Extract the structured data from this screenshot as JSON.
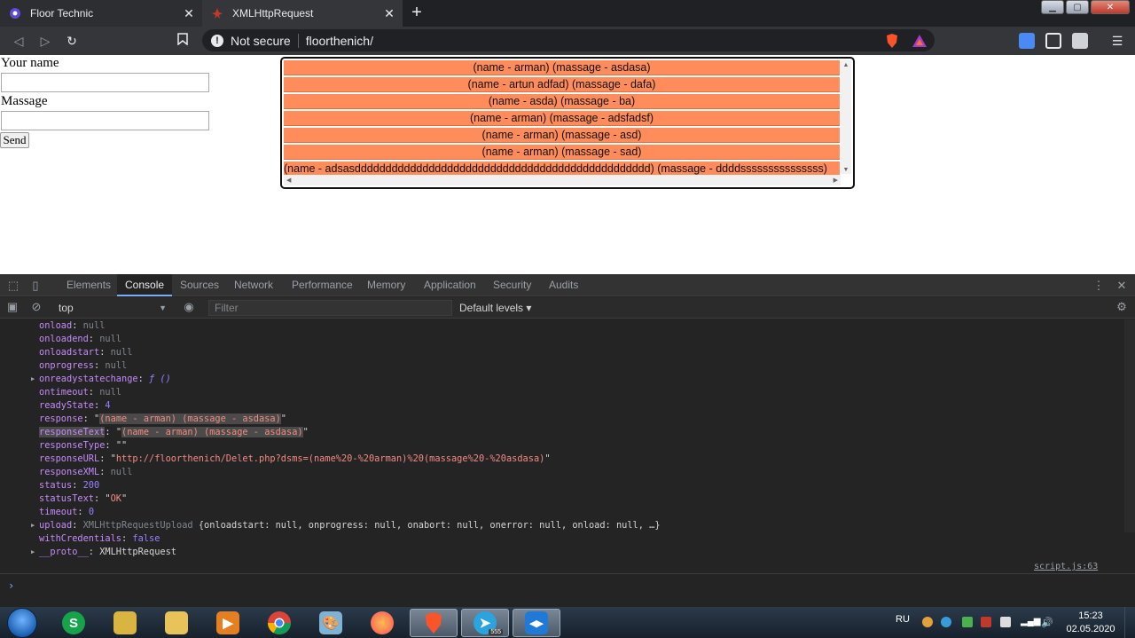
{
  "browser": {
    "tabs": [
      {
        "title": "Floor Technic",
        "close": "✕"
      },
      {
        "title": "XMLHttpRequest",
        "close": "✕"
      }
    ],
    "new_tab": "+",
    "security_label": "Not secure",
    "url": "floorthenich/",
    "colors": {
      "tabstrip": "#202124",
      "toolbar": "#35363a"
    }
  },
  "page": {
    "name_label": "Your name",
    "name_value": "",
    "message_label": "Massage",
    "message_value": "",
    "send_label": "Send",
    "messages": [
      "(name - arman) (massage - asdasa)",
      "(name - artun adfad) (massage - dafa)",
      "(name - asda) (massage - ba)",
      "(name - arman) (massage - adsfadsf)",
      "(name - arman) (massage - asd)",
      "(name - arman) (massage - sad)",
      "(name - adsasdddddddddddddddddddddddddddddddddddddddddddddddd) (massage - ddddsssssssssssssss)"
    ],
    "message_row_color": "#ff8c5a"
  },
  "devtools": {
    "tabs": [
      "Elements",
      "Console",
      "Sources",
      "Network",
      "Performance",
      "Memory",
      "Application",
      "Security",
      "Audits"
    ],
    "active_tab": "Console",
    "context": "top",
    "filter_placeholder": "Filter",
    "levels": "Default levels ▾",
    "source_link": "script.js:63",
    "props": [
      {
        "key": "onload",
        "val": "null",
        "type": "null"
      },
      {
        "key": "onloadend",
        "val": "null",
        "type": "null"
      },
      {
        "key": "onloadstart",
        "val": "null",
        "type": "null"
      },
      {
        "key": "onprogress",
        "val": "null",
        "type": "null"
      },
      {
        "key": "onreadystatechange",
        "val": "ƒ ()",
        "type": "fn",
        "expand": true
      },
      {
        "key": "ontimeout",
        "val": "null",
        "type": "null"
      },
      {
        "key": "readyState",
        "val": "4",
        "type": "num"
      },
      {
        "key": "response",
        "val": "(name - arman) (massage - asdasa)",
        "type": "str",
        "highlight": true
      },
      {
        "key": "responseText",
        "val": "(name - arman) (massage - asdasa)",
        "type": "str",
        "highlight": true,
        "key_highlight": true
      },
      {
        "key": "responseType",
        "val": "",
        "type": "str"
      },
      {
        "key": "responseURL",
        "val": "http://floorthenich/Delet.php?dsms=(name%20-%20arman)%20(massage%20-%20asdasa)",
        "type": "str"
      },
      {
        "key": "responseXML",
        "val": "null",
        "type": "null"
      },
      {
        "key": "status",
        "val": "200",
        "type": "num"
      },
      {
        "key": "statusText",
        "val": "OK",
        "type": "str"
      },
      {
        "key": "timeout",
        "val": "0",
        "type": "num"
      },
      {
        "key": "upload",
        "val": "XMLHttpRequestUpload",
        "type": "obj",
        "expand": true,
        "tail": "{onloadstart: null, onprogress: null, onabort: null, onerror: null, onload: null, …}"
      },
      {
        "key": "withCredentials",
        "val": "false",
        "type": "num"
      },
      {
        "key": "__proto__",
        "val": "XMLHttpRequest",
        "type": "plain",
        "expand": true
      }
    ],
    "prompt": "›"
  },
  "taskbar": {
    "language": "RU",
    "time": "15:23",
    "date": "02.05.2020",
    "telegram_badge": "555",
    "apps": [
      "skype",
      "folder",
      "explorer",
      "media-player",
      "chrome",
      "paint",
      "firefox",
      "brave",
      "telegram",
      "vscode"
    ]
  }
}
